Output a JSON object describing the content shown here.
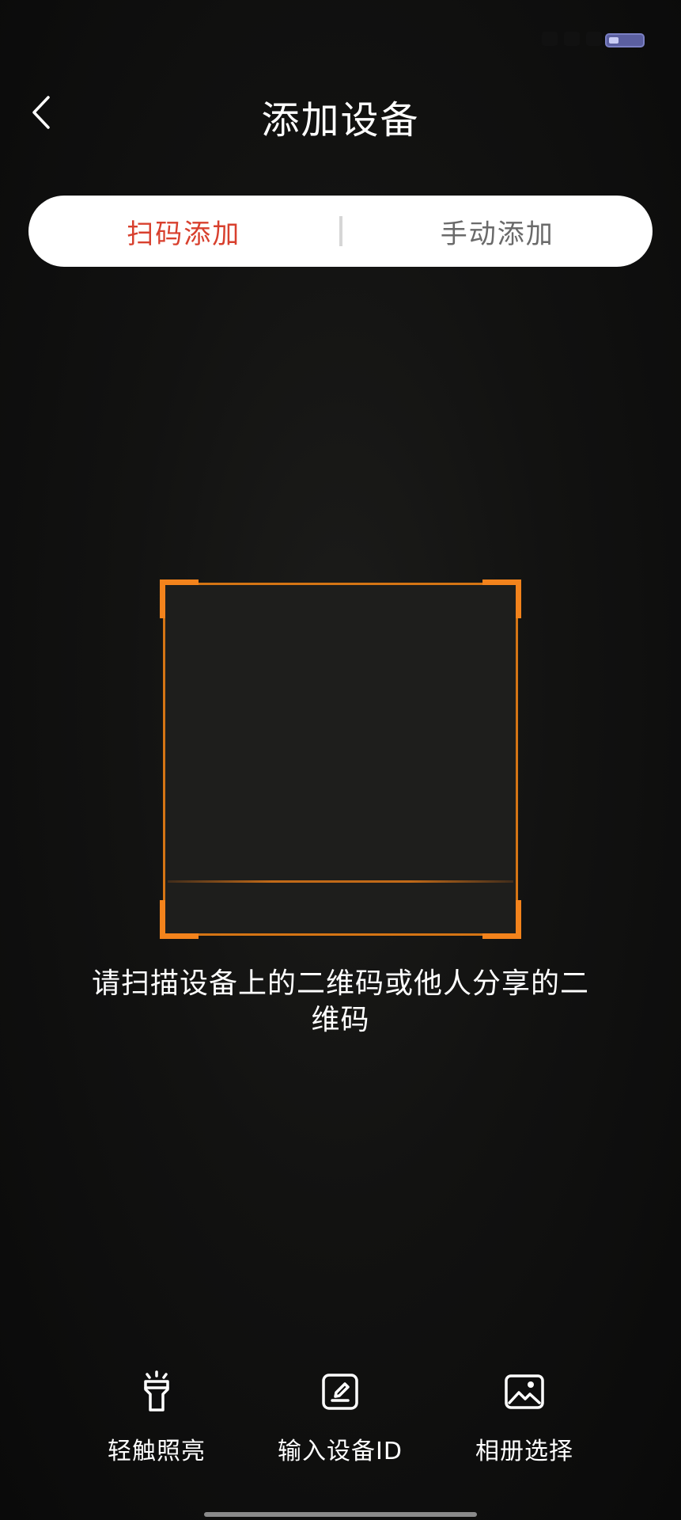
{
  "header": {
    "title": "添加设备"
  },
  "tabs": [
    {
      "label": "扫码添加",
      "active": true
    },
    {
      "label": "手动添加",
      "active": false
    }
  ],
  "scanner": {
    "hint": "请扫描设备上的二维码或他人分享的二维码"
  },
  "actions": [
    {
      "label": "轻触照亮",
      "icon": "flashlight-icon"
    },
    {
      "label": "输入设备ID",
      "icon": "edit-id-icon"
    },
    {
      "label": "相册选择",
      "icon": "image-icon"
    }
  ],
  "colors": {
    "accent_tab": "#d8402e",
    "scan_frame": "#f3831c",
    "background": "#121211"
  }
}
